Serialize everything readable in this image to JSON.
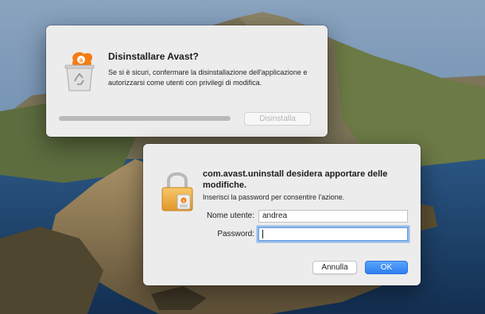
{
  "desktop": {
    "wallpaper": "macos-catalina-island"
  },
  "uninstall_dialog": {
    "icon": "avast-uninstaller-icon",
    "title": "Disinstallare Avast?",
    "message": "Se si è sicuri, confermare la disinstallazione dell'applicazione e autorizzarsi come utenti con privilegi di modifica.",
    "progress": 1.0,
    "button_label": "Disinstalla"
  },
  "auth_dialog": {
    "icon": "lock-icon",
    "title": "com.avast.uninstall desidera apportare delle modifiche.",
    "message": "Inserisci la password per consentire l'azione.",
    "username_label": "Nome utente:",
    "username_value": "andrea",
    "password_label": "Password:",
    "password_value": "",
    "cancel_label": "Annulla",
    "ok_label": "OK"
  },
  "colors": {
    "accent": "#2e7ff2",
    "avast_orange": "#f57c13",
    "dialog_bg": "#ececec"
  }
}
